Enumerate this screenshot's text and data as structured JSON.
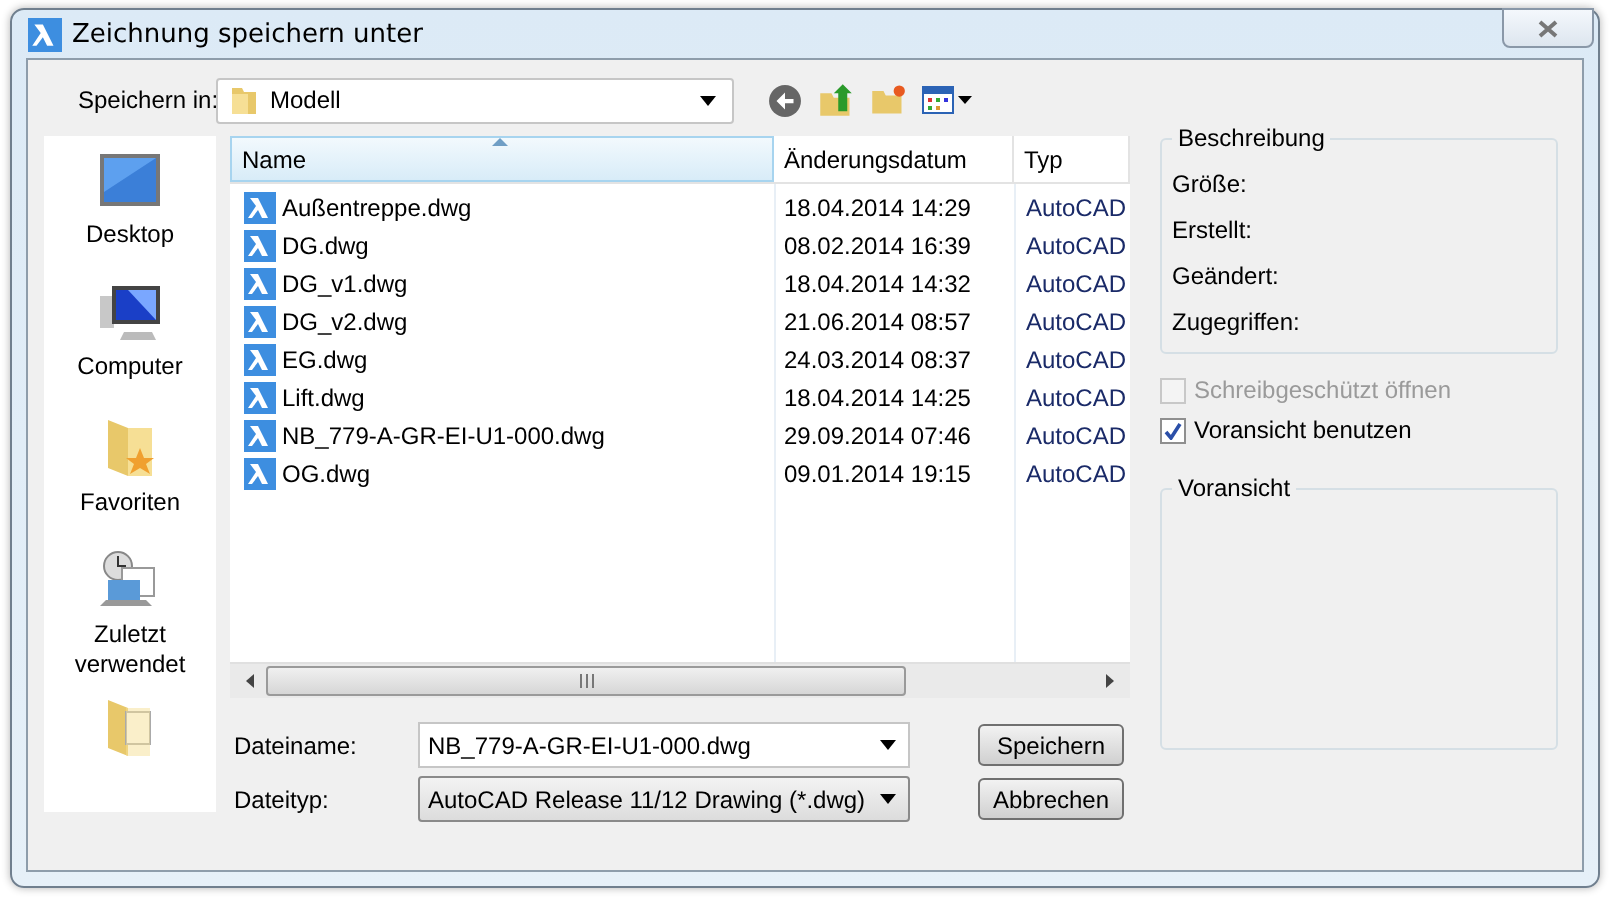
{
  "window": {
    "title": "Zeichnung speichern unter"
  },
  "save_in": {
    "label": "Speichern in:",
    "value": "Modell"
  },
  "places": [
    {
      "kind": "desktop",
      "label": "Desktop"
    },
    {
      "kind": "computer",
      "label": "Computer"
    },
    {
      "kind": "favorites",
      "label": "Favoriten"
    },
    {
      "kind": "recent",
      "label": "Zuletzt verwendet"
    },
    {
      "kind": "documents"
    }
  ],
  "file_list": {
    "columns": [
      {
        "label": "Name",
        "sorted": true
      },
      {
        "label": "Änderungsdatum",
        "sorted": false
      },
      {
        "label": "Typ",
        "sorted": false
      }
    ],
    "rows": [
      {
        "name": "Außentreppe.dwg",
        "modified": "18.04.2014 14:29",
        "type": "AutoCAD"
      },
      {
        "name": "DG.dwg",
        "modified": "08.02.2014 16:39",
        "type": "AutoCAD"
      },
      {
        "name": "DG_v1.dwg",
        "modified": "18.04.2014 14:32",
        "type": "AutoCAD"
      },
      {
        "name": "DG_v2.dwg",
        "modified": "21.06.2014 08:57",
        "type": "AutoCAD"
      },
      {
        "name": "EG.dwg",
        "modified": "24.03.2014 08:37",
        "type": "AutoCAD"
      },
      {
        "name": "Lift.dwg",
        "modified": "18.04.2014 14:25",
        "type": "AutoCAD"
      },
      {
        "name": "NB_779-A-GR-EI-U1-000.dwg",
        "modified": "29.09.2014 07:46",
        "type": "AutoCAD"
      },
      {
        "name": "OG.dwg",
        "modified": "09.01.2014 19:15",
        "type": "AutoCAD"
      }
    ]
  },
  "filename": {
    "label": "Dateiname:",
    "value": "NB_779-A-GR-EI-U1-000.dwg"
  },
  "filetype": {
    "label": "Dateityp:",
    "value": "AutoCAD Release 11/12 Drawing (*.dwg)"
  },
  "buttons": [
    {
      "label": "Speichern"
    },
    {
      "label": "Abbrechen"
    }
  ],
  "description": {
    "title": "Beschreibung",
    "fields": [
      "Größe:",
      "Erstellt:",
      "Geändert:",
      "Zugegriffen:"
    ]
  },
  "options": [
    {
      "label": "Schreibgeschützt öffnen",
      "checked": false,
      "disabled": true
    },
    {
      "label": "Voransicht benutzen",
      "checked": true,
      "disabled": false
    }
  ],
  "preview": {
    "title": "Voransicht"
  }
}
